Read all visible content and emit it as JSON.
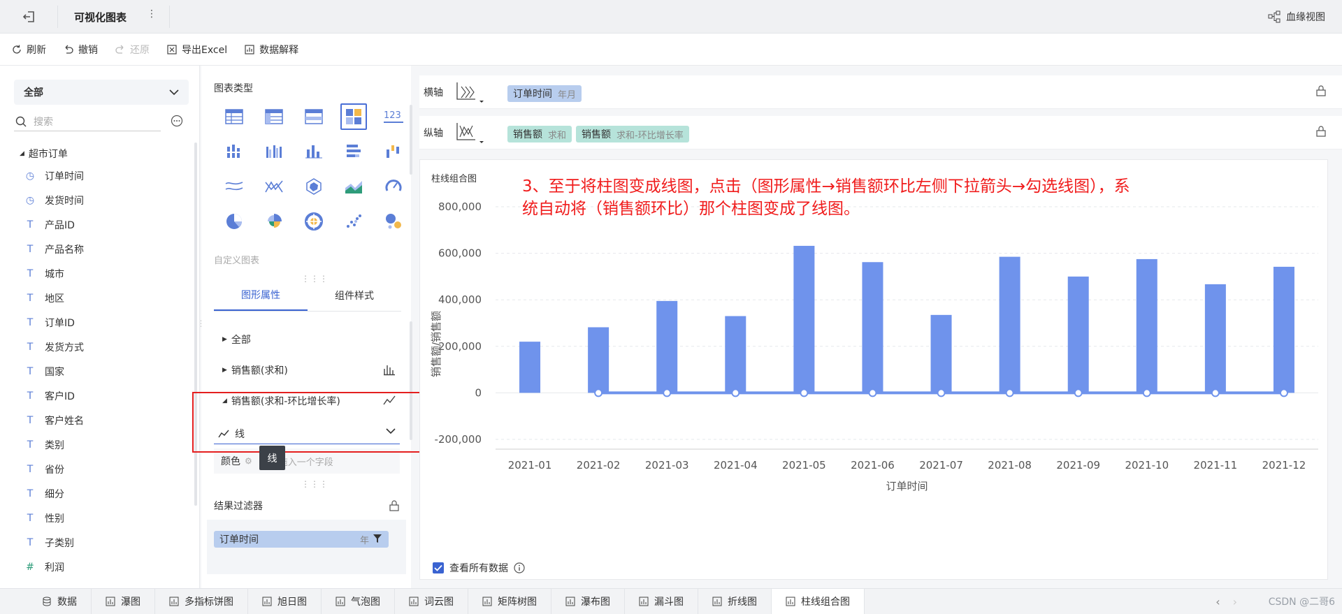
{
  "titlebar": {
    "title": "可视化图表",
    "more": "⋮",
    "lineage": "血缘视图"
  },
  "toolbar": {
    "refresh": "刷新",
    "undo": "撤销",
    "redo": "还原",
    "export": "导出Excel",
    "explain": "数据解释"
  },
  "left": {
    "scope": "全部",
    "search_placeholder": "搜索",
    "root": "超市订单",
    "fields": [
      {
        "icon": "clock",
        "label": "订单时间"
      },
      {
        "icon": "clock",
        "label": "发货时间"
      },
      {
        "icon": "T",
        "label": "产品ID"
      },
      {
        "icon": "T",
        "label": "产品名称"
      },
      {
        "icon": "T",
        "label": "城市"
      },
      {
        "icon": "T",
        "label": "地区"
      },
      {
        "icon": "T",
        "label": "订单ID"
      },
      {
        "icon": "T",
        "label": "发货方式"
      },
      {
        "icon": "T",
        "label": "国家"
      },
      {
        "icon": "T",
        "label": "客户ID"
      },
      {
        "icon": "T",
        "label": "客户姓名"
      },
      {
        "icon": "T",
        "label": "类别"
      },
      {
        "icon": "T",
        "label": "省份"
      },
      {
        "icon": "T",
        "label": "细分"
      },
      {
        "icon": "T",
        "label": "性别"
      },
      {
        "icon": "T",
        "label": "子类别"
      },
      {
        "icon": "#",
        "label": "利润"
      }
    ]
  },
  "mid": {
    "chart_types_title": "图表类型",
    "custom_chart": "自定义图表",
    "tab_props": "图形属性",
    "tab_style": "组件样式",
    "prop_all": "全部",
    "prop_sum": "销售额(求和)",
    "prop_growth": "销售额(求和-环比增长率)",
    "mark_type": "线",
    "color_label": "颜色",
    "color_placeholder": "拖入一个字段",
    "tooltip": "线",
    "filter_title": "结果过滤器",
    "filter_field": "订单时间",
    "filter_agg": "年"
  },
  "axes": {
    "x_label": "横轴",
    "y_label": "纵轴",
    "x_pill": {
      "field": "订单时间",
      "sub": "年月"
    },
    "y_pills": [
      {
        "field": "销售额",
        "sub": "求和"
      },
      {
        "field": "销售额",
        "sub": "求和-环比增长率"
      }
    ]
  },
  "card": {
    "title": "柱线组合图",
    "annotation": "3、至于将柱图变成线图，点击（图形属性→销售额环比左侧下拉箭头→勾选线图），系统自动将（销售额环比）那个柱图变成了线图。",
    "show_all": "查看所有数据"
  },
  "chart_data": {
    "type": "bar",
    "title": "柱线组合图",
    "xlabel": "订单时间",
    "ylabel": "销售额/销售额",
    "categories": [
      "2021-01",
      "2021-02",
      "2021-03",
      "2021-04",
      "2021-05",
      "2021-06",
      "2021-07",
      "2021-08",
      "2021-09",
      "2021-10",
      "2021-11",
      "2021-12"
    ],
    "series": [
      {
        "type": "bar",
        "values": [
          220000,
          282000,
          395000,
          330000,
          632000,
          562000,
          335000,
          585000,
          500000,
          575000,
          467000,
          542000
        ],
        "color": "#6f93ec"
      },
      {
        "type": "line",
        "values": [
          null,
          0,
          0,
          0,
          0,
          0,
          0,
          0,
          0,
          0,
          0,
          0
        ],
        "color": "#6f93ec"
      }
    ],
    "yticks": [
      "800,000",
      "600,000",
      "400,000",
      "200,000",
      "0",
      "-200,000"
    ],
    "ylim": [
      -200000,
      800000
    ],
    "grid": true
  },
  "bottom_tabs": [
    {
      "label": "数据",
      "active": false
    },
    {
      "label": "瀑图",
      "active": false
    },
    {
      "label": "多指标饼图",
      "active": false
    },
    {
      "label": "旭日图",
      "active": false
    },
    {
      "label": "气泡图",
      "active": false
    },
    {
      "label": "词云图",
      "active": false
    },
    {
      "label": "矩阵树图",
      "active": false
    },
    {
      "label": "瀑布图",
      "active": false
    },
    {
      "label": "漏斗图",
      "active": false
    },
    {
      "label": "折线图",
      "active": false
    },
    {
      "label": "柱线组合图",
      "active": true
    }
  ],
  "watermark": "CSDN @二哥6",
  "colors": {
    "accent": "#3a63d1",
    "bar": "#6f93ec",
    "annotation": "#f01c1c"
  }
}
